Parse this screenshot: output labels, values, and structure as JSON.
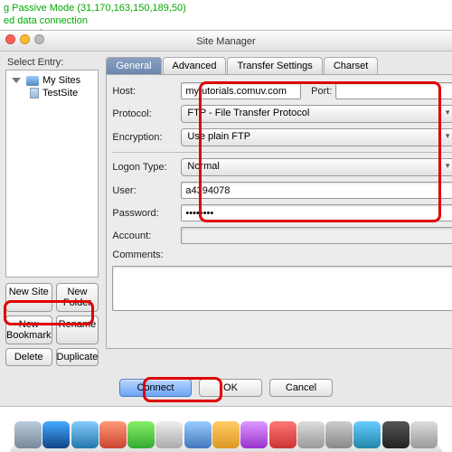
{
  "terminal": {
    "line1": "g Passive Mode (31,170,163,150,189,50)",
    "line2": "ed data connection",
    "line3": "nse: -a -l"
  },
  "window": {
    "title": "Site Manager"
  },
  "leftPanel": {
    "label": "Select Entry:",
    "rootFolder": "My Sites",
    "site": "TestSite",
    "buttons": {
      "newSite": "New Site",
      "newFolder": "New Folder",
      "newBookmark": "New Bookmark",
      "rename": "Rename",
      "delete": "Delete",
      "duplicate": "Duplicate"
    }
  },
  "tabs": {
    "general": "General",
    "advanced": "Advanced",
    "transfer": "Transfer Settings",
    "charset": "Charset"
  },
  "form": {
    "hostLabel": "Host:",
    "hostValue": "mytutorials.comuv.com",
    "portLabel": "Port:",
    "portValue": "",
    "protocolLabel": "Protocol:",
    "protocolValue": "FTP - File Transfer Protocol",
    "encryptionLabel": "Encryption:",
    "encryptionValue": "Use plain FTP",
    "logonLabel": "Logon Type:",
    "logonValue": "Normal",
    "userLabel": "User:",
    "userValue": "a4394078",
    "passwordLabel": "Password:",
    "passwordValue": "••••••••",
    "accountLabel": "Account:",
    "accountValue": "",
    "commentsLabel": "Comments:"
  },
  "bottom": {
    "connect": "Connect",
    "ok": "OK",
    "cancel": "Cancel"
  }
}
